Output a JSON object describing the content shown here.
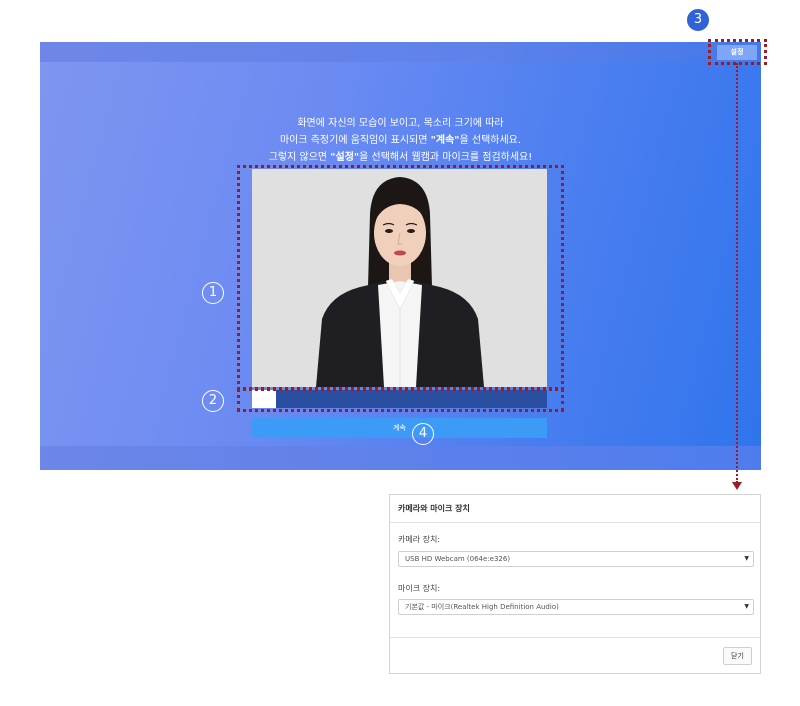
{
  "app": {
    "settings_label": "설정",
    "instructions": {
      "line1": "화면에 자신의 모습이 보이고, 목소리 크기에 따라",
      "line2_pre": "마이크 측정기에 움직임이 표시되면 ",
      "line2_bold": "\"계속\"",
      "line2_post": "을 선택하세요.",
      "line3_pre": "그렇지 않으면 ",
      "line3_bold": "\"설정\"",
      "line3_post": "을 선택해서 웹캠과 마이크를 점검하세요!"
    },
    "mic_level": 0.08,
    "continue_label": "계속"
  },
  "annotations": {
    "webcam_number": "1",
    "mic_number": "2",
    "settings_number": "3",
    "continue_number": "4",
    "color": "#9b1c22"
  },
  "dialog": {
    "title": "카메라와 마이크 장치",
    "camera_label": "카메라 장치:",
    "camera_value": "USB HD Webcam (064e:e326)",
    "mic_label": "마이크 장치:",
    "mic_value": "기본값 - 마이크(Realtek High Definition Audio)",
    "close_label": "닫기"
  },
  "icons": {
    "select_caret": "chevron-down-icon"
  },
  "colors": {
    "continue_button": "#3d9bf8",
    "settings_button": "#7da6f4",
    "meter_track": "#2a4ea0"
  }
}
